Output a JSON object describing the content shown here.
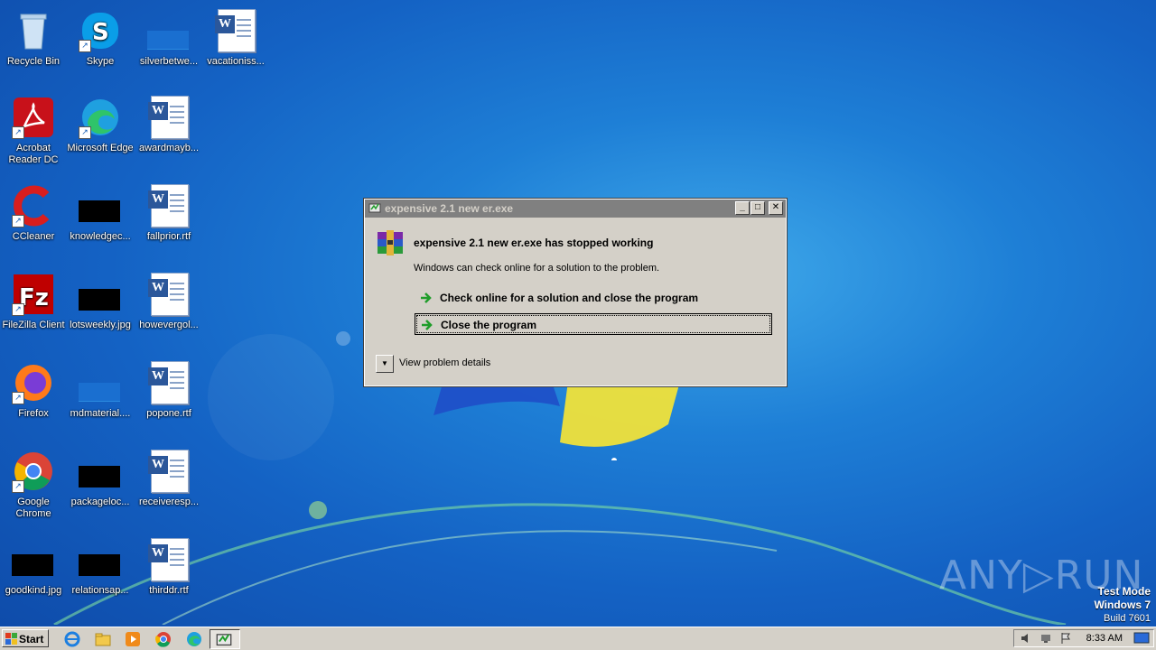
{
  "desktop": {
    "icons": [
      {
        "label": "Recycle Bin"
      },
      {
        "label": "Skype"
      },
      {
        "label": "silverbetwe..."
      },
      {
        "label": "vacationiss..."
      },
      {
        "label": "Acrobat Reader DC"
      },
      {
        "label": "Microsoft Edge"
      },
      {
        "label": "awardmayb..."
      },
      {
        "label": "CCleaner"
      },
      {
        "label": "knowledgec..."
      },
      {
        "label": "fallprior.rtf"
      },
      {
        "label": "FileZilla Client"
      },
      {
        "label": "lotsweekly.jpg"
      },
      {
        "label": "howevergol..."
      },
      {
        "label": "Firefox"
      },
      {
        "label": "mdmaterial...."
      },
      {
        "label": "popone.rtf"
      },
      {
        "label": "Google Chrome"
      },
      {
        "label": "packageloc..."
      },
      {
        "label": "receiveresp..."
      },
      {
        "label": "goodkind.jpg"
      },
      {
        "label": "relationsap..."
      },
      {
        "label": "thirddr.rtf"
      }
    ]
  },
  "dialog": {
    "title": "expensive 2.1 new er.exe",
    "heading": "expensive 2.1 new er.exe has stopped working",
    "message": "Windows can check online for a solution to the problem.",
    "option_check_online": "Check online for a solution and close the program",
    "option_close": "Close the program",
    "view_details": "View problem details",
    "minimize_glyph": "_",
    "maximize_glyph": "□",
    "close_glyph": "✕"
  },
  "watermark": {
    "text": "ANY▷RUN",
    "line1": "Test Mode",
    "line2": "Windows 7",
    "line3": "Build 7601"
  },
  "taskbar": {
    "start_label": "Start",
    "clock": "8:33 AM",
    "icons": [
      "ie-icon",
      "explorer-icon",
      "media-player-icon",
      "chrome-icon",
      "edge-icon",
      "error-report-icon"
    ]
  },
  "colors": {
    "desktop_bg": "#1e7fd6",
    "dialog_bg": "#d4d0c8",
    "titlebar_inactive": "#808080",
    "arrow_green": "#1f9d2a"
  }
}
